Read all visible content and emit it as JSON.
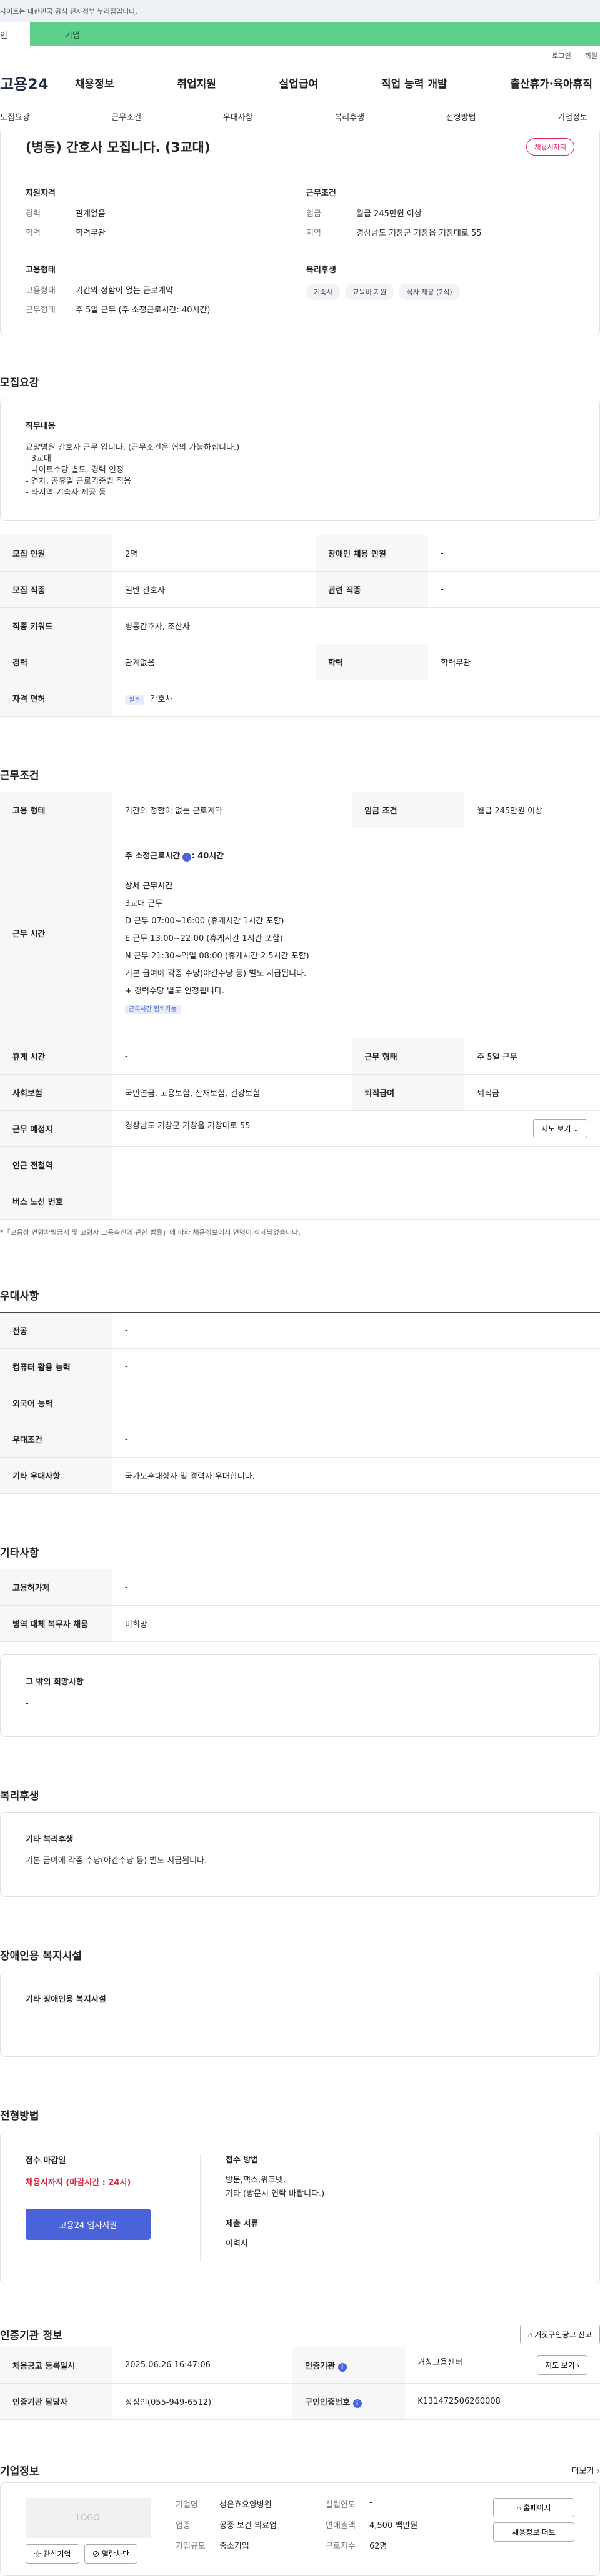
{
  "topbar": {
    "notice": "사이트는 대한민국 공식 전자정부 누리집입니다."
  },
  "tabs": {
    "individual": "인",
    "corporate": "기업"
  },
  "util": {
    "login": "로그인",
    "join": "회원"
  },
  "gnb": {
    "logo": "고용24",
    "menu": [
      "채용정보",
      "취업지원",
      "실업급여",
      "직업 능력 개발",
      "출산휴가·육아휴직"
    ]
  },
  "subnav": [
    "모집요강",
    "근무조건",
    "우대사항",
    "복리후생",
    "전형방법",
    "기업정보"
  ],
  "summary": {
    "title": "(병동) 간호사 모집니다. (3교대)",
    "badge": "채용시까지",
    "qual_title": "지원자격",
    "cond_title": "근무조건",
    "emp_title": "고용형태",
    "welfare_title": "복리후생",
    "qual": [
      {
        "k": "경력",
        "v": "관계없음"
      },
      {
        "k": "학력",
        "v": "학력무관"
      }
    ],
    "cond": [
      {
        "k": "임금",
        "v": "월급 245만원 이상"
      },
      {
        "k": "지역",
        "v": "경상남도 거창군 거창읍 거창대로 55"
      }
    ],
    "emp": [
      {
        "k": "고용형태",
        "v": "기간의 정함이 없는 근로계약"
      },
      {
        "k": "근무형태",
        "v": "주 5일 근무 (주 소정근로시간: 40시간)"
      }
    ],
    "welfare_chips": [
      "기숙사",
      "교육비 지원",
      "식사 제공 (2식)"
    ]
  },
  "recruit": {
    "title": "모집요강",
    "duty_title": "직무내용",
    "duty_lines": [
      "요양병원 간호사 근무 입니다. (근무조건은  협의 가능하십니다.)",
      "- 3교대",
      "- 나이트수당 별도, 경력 인정",
      "- 연차, 공휴일 근로기준법 적용",
      "- 타지역 기숙사 제공 등"
    ],
    "rows": [
      {
        "k1": "모집 인원",
        "v1": "2명",
        "k2": "장애인 채용 인원",
        "v2": "-"
      },
      {
        "k1": "모집 직종",
        "v1": "일반 간호사",
        "k2": "관련 직종",
        "v2": "-"
      },
      {
        "k1": "직종 키워드",
        "v1": "병동간호사, 조산사",
        "k2": "",
        "v2": ""
      },
      {
        "k1": "경력",
        "v1": "관계없음",
        "k2": "학력",
        "v2": "학력무관"
      }
    ],
    "license_label": "자격 면허",
    "license_badge": "필수",
    "license_value": "간호사"
  },
  "work": {
    "title": "근무조건",
    "emp_type_label": "고용 형태",
    "emp_type": "기간의 정함이 없는 근로계약",
    "wage_label": "임금 조건",
    "wage": "월급 245만원 이상",
    "hours_label": "근무 시간",
    "hours_head": "주 소정근로시간",
    "hours_value": ": 40시간",
    "detail_title": "상세 근무시간",
    "detail_lines": [
      "3교대 근무",
      "D 근무 07:00~16:00  (휴게시간 1시간 포함)",
      "E 근무 13:00~22:00  (휴게시간 1시간 포함)",
      "N 근무 21:30~익일 08:00  (휴게시간 2.5시간 포함)",
      "기본 급여에 각종 수당(야간수당 등) 별도 지급됩니다.",
      "+ 경력수당 별도 인정됩니다."
    ],
    "nego_badge": "근무시간 협의가능",
    "rows": [
      {
        "k1": "휴게 시간",
        "v1": "-",
        "k2": "근무 형태",
        "v2": "주 5일 근무"
      },
      {
        "k1": "사회보험",
        "v1": "국민연금, 고용보험, 산재보험, 건강보험",
        "k2": "퇴직급여",
        "v2": "퇴직금"
      }
    ],
    "place_label": "근무 예정지",
    "place": "경상남도 거창군 거창읍 거창대로 55",
    "map_btn": "지도 보기",
    "station_label": "인근 전철역",
    "station": "-",
    "bus_label": "버스 노선 번호",
    "bus": "-",
    "note": "*「고용상 연령차별금지 및 고령자 고용촉진에 관한 법률」에 따라 채용정보에서 연령이 삭제되었습니다."
  },
  "pref": {
    "title": "우대사항",
    "rows": [
      {
        "k": "전공",
        "v": "-"
      },
      {
        "k": "컴퓨터 활용 능력",
        "v": "-"
      },
      {
        "k": "외국어 능력",
        "v": "-"
      },
      {
        "k": "우대조건",
        "v": "-"
      },
      {
        "k": "기타 우대사항",
        "v": "국가보훈대상자 및 경력자 우대합니다."
      }
    ]
  },
  "etc": {
    "title": "기타사항",
    "rows": [
      {
        "k": "고용허가제",
        "v": "-"
      },
      {
        "k": "병역 대체 복무자 채용",
        "v": "비희망"
      }
    ],
    "other_title": "그 밖의 희망사항",
    "other": "-"
  },
  "welfare": {
    "title": "복리후생",
    "box_title": "기타 복리후생",
    "box_text": "기본 급여에 각종 수당(야간수당 등) 별도 지급됩니다."
  },
  "disabled": {
    "title": "장애인용 복지시설",
    "box_title": "기타 장애인용 복지시설",
    "box_text": "-"
  },
  "apply": {
    "title": "전형방법",
    "deadline_label": "접수 마감일",
    "deadline": "채용시까지 (마감시간 : 24시)",
    "button": "고용24 입사지원",
    "method_label": "접수 방법",
    "method_lines": [
      "방문,팩스,워크넷,",
      "기타 (방문시 연락 바랍니다.)"
    ],
    "docs_label": "제출 서류",
    "docs": "이력서"
  },
  "cert": {
    "title": "인증기관 정보",
    "btn": "거짓구인광고 신고",
    "rows": [
      {
        "k1": "채용공고 등록일시",
        "v1": "2025.06.26 16:47:06",
        "k2": "인증기관",
        "v2": "거창고용센터"
      },
      {
        "k1": "인증기관 담당자",
        "v1": "장정인(055-949-6512)",
        "k2": "구인인증번호",
        "v2": "K131472506260008"
      }
    ],
    "map_btn": "지도 보기"
  },
  "company": {
    "title": "기업정보",
    "more": "더보기",
    "logo": "LOGO",
    "fav_btn": "관심기업",
    "block_btn": "열람차단",
    "fields": [
      {
        "k1": "기업명",
        "v1": "성은효요양병원",
        "k2": "설립연도",
        "v2": "-"
      },
      {
        "k1": "업종",
        "v1": "공중 보건 의료업",
        "k2": "연매출액",
        "v2": "4,500 백만원"
      },
      {
        "k1": "기업규모",
        "v1": "중소기업",
        "k2": "근로자수",
        "v2": "62명"
      }
    ],
    "home_btn": "홈페이지",
    "jobs_btn": "채용정보 더보"
  }
}
